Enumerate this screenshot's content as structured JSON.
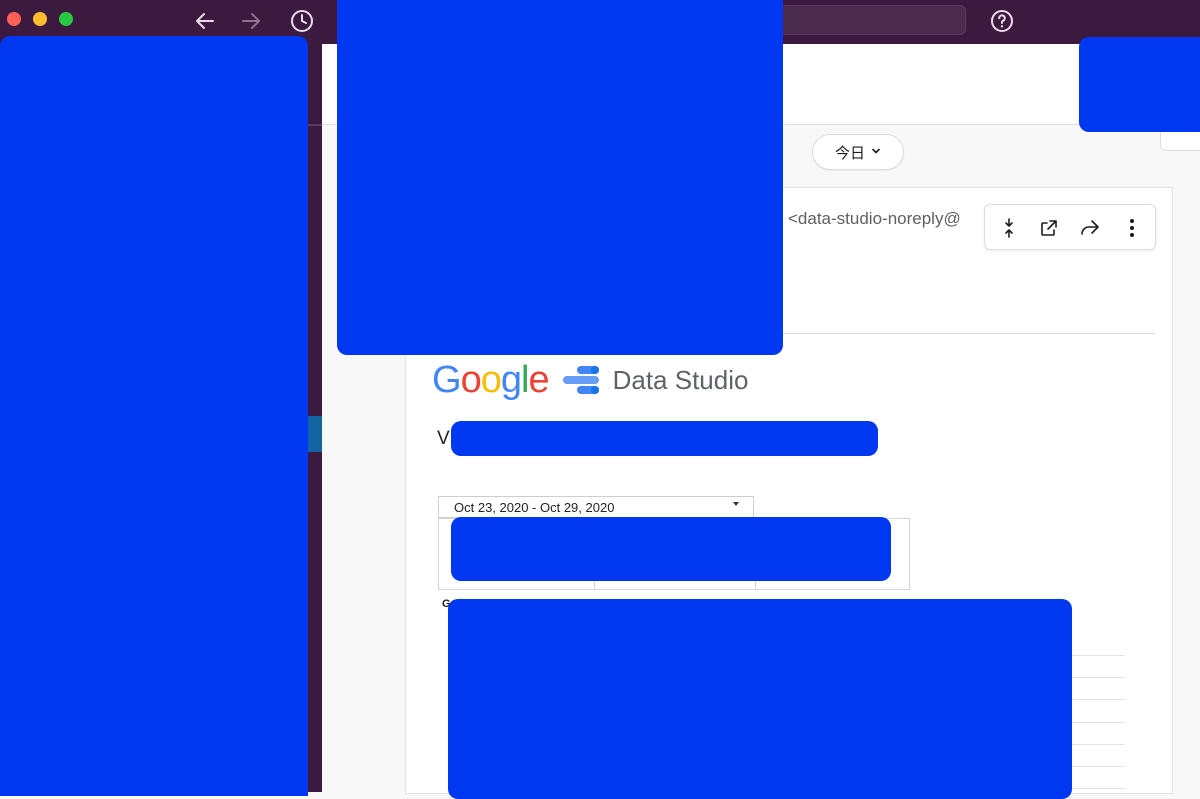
{
  "window": {
    "traffic_lights": [
      "#fe5f57",
      "#febc2e",
      "#28c840"
    ]
  },
  "toolbar": {
    "back_icon": "arrow-left-icon",
    "forward_icon": "arrow-right-icon",
    "history_icon": "clock-icon",
    "help_icon": "question-circle-icon"
  },
  "channel": {
    "date_divider_label": "今日"
  },
  "message": {
    "sender_email": "<data-studio-noreply@"
  },
  "message_actions": [
    {
      "icon": "collapse-icon"
    },
    {
      "icon": "open-external-icon"
    },
    {
      "icon": "share-forward-icon"
    },
    {
      "icon": "more-vertical-icon"
    }
  ],
  "email": {
    "logo_text": "Google",
    "product_text": "Data Studio",
    "heading_first_letter": "V",
    "date_range": "Oct 23, 2020 - Oct 29, 2020",
    "section_label": "G"
  },
  "colors": {
    "sidebar": "#3c1a3f",
    "redaction": "#0037f0",
    "selected_channel": "#1264a3"
  }
}
